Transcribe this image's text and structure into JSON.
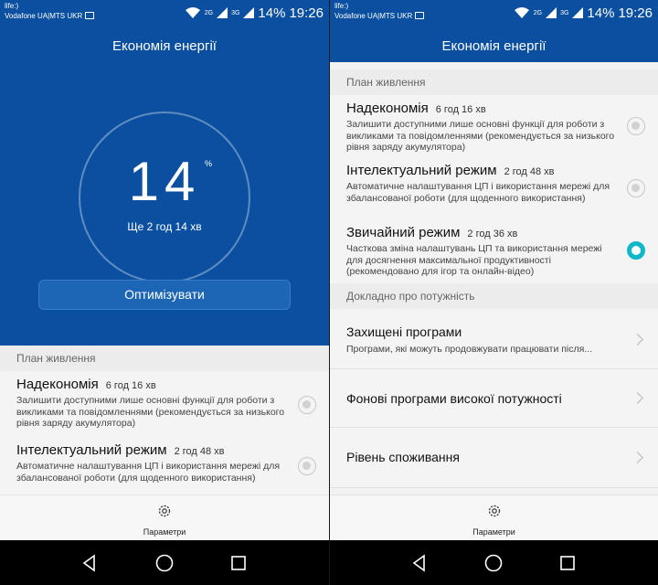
{
  "status": {
    "carrier_line1": "life:)",
    "carrier_line2": "Vodafone UA|MTS UKR",
    "net_a": "2G",
    "net_b": "3G",
    "battery": "14%",
    "time": "19:26"
  },
  "header": {
    "title": "Економія енергії"
  },
  "battery": {
    "percent": "14",
    "percent_sign": "%",
    "remaining": "Ще 2 год 14 хв",
    "optimize_label": "Оптимізувати"
  },
  "power_plan": {
    "heading": "План живлення",
    "plans": [
      {
        "name": "Надекономія",
        "time": "6 год 16 хв",
        "desc": "Залишити доступними лише основні функції для роботи з викликами та повідомленнями (рекомендується за низького рівня заряду акумулятора)",
        "selected": false
      },
      {
        "name": "Інтелектуальний режим",
        "time": "2 год 48 хв",
        "desc": "Автоматичне налаштування ЦП і використання мережі для збалансованої роботи (для щоденного використання)",
        "selected": false
      },
      {
        "name": "Звичайний режим",
        "time": "2 год 36 хв",
        "desc": "Часткова зміна налаштувань ЦП та використання мережі для досягнення максимальної продуктивності (рекомендовано для ігор та онлайн-відео)",
        "selected": true
      }
    ]
  },
  "details": {
    "heading": "Докладно про потужність",
    "items": [
      {
        "label": "Захищені програми",
        "sub": "Програми, які можуть продовжувати працювати після..."
      },
      {
        "label": "Фонові програми високої потужності",
        "sub": ""
      },
      {
        "label": "Рівень споживання",
        "sub": ""
      }
    ]
  },
  "toolbar": {
    "settings_label": "Параметри"
  },
  "colors": {
    "header_blue": "#0a4fa0",
    "accent_teal": "#0fb8c9"
  },
  "icons": [
    "wifi-icon",
    "signal-icon",
    "image-icon",
    "gear-icon",
    "back-icon",
    "home-icon",
    "recents-icon",
    "chevron-right-icon"
  ]
}
